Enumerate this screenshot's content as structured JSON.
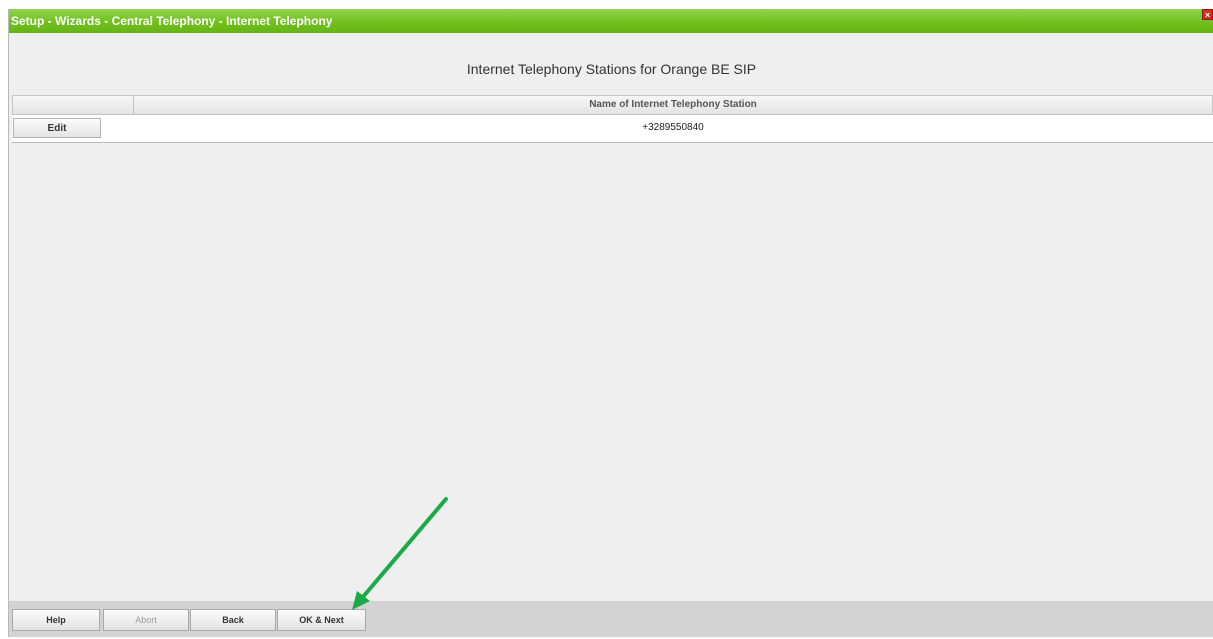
{
  "window": {
    "title": "Setup - Wizards - Central Telephony - Internet Telephony",
    "close_glyph": "×"
  },
  "main": {
    "heading": "Internet Telephony Stations for Orange BE SIP",
    "table": {
      "columns": [
        "",
        "Name of Internet Telephony Station"
      ],
      "rows": [
        {
          "action_label": "Edit",
          "name": "+3289550840"
        }
      ]
    }
  },
  "footer": {
    "buttons": [
      {
        "label": "Help",
        "enabled": true
      },
      {
        "label": "Abort",
        "enabled": false
      },
      {
        "label": "Back",
        "enabled": true
      },
      {
        "label": "OK & Next",
        "enabled": true
      }
    ]
  },
  "annotation": {
    "arrow_color": "#1aab48",
    "target": "OK & Next"
  },
  "colors": {
    "titlebar": "#71c01f",
    "background": "#efefef",
    "footer": "#d3d3d3",
    "close_button": "#d62b1e"
  }
}
